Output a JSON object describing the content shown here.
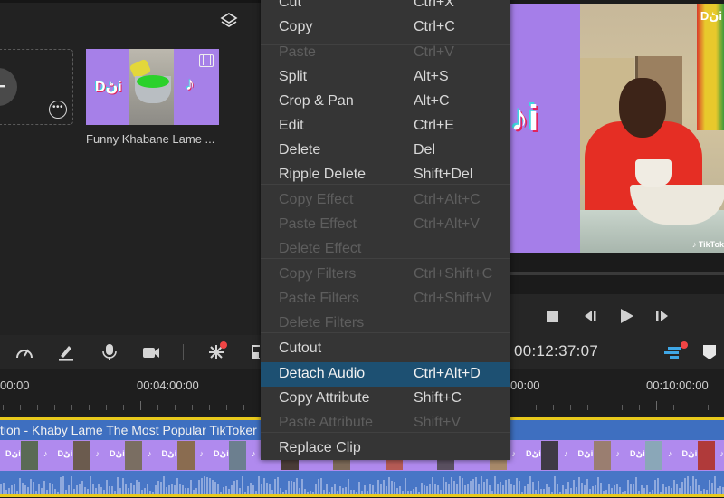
{
  "media": {
    "clip_label": "Funny Khabane Lame ...",
    "thumb_logo_left": "Dڻi",
    "thumb_logo_right": "♪"
  },
  "preview": {
    "watermark": "Dڻi",
    "tiktok_tag": "♪ TikTok",
    "side_logo": "♪i"
  },
  "toolbar": {
    "timecode": "00:12:37:07"
  },
  "ruler": {
    "labels": [
      "00:00",
      "00:04:00:00",
      "00:00",
      "00:10:00:00"
    ]
  },
  "track": {
    "title": "tion - Khaby Lame The Most Popular TikToker of Ap",
    "frame_logo": "Dڻi",
    "frame_logo2": "♪"
  },
  "context_menu": {
    "items": [
      {
        "label": "Cut",
        "shortcut": "Ctrl+X",
        "enabled": true
      },
      {
        "label": "Copy",
        "shortcut": "Ctrl+C",
        "enabled": true
      },
      {
        "label": "Paste",
        "shortcut": "Ctrl+V",
        "enabled": false
      },
      {
        "label": "Split",
        "shortcut": "Alt+S",
        "enabled": true
      },
      {
        "label": "Crop & Pan",
        "shortcut": "Alt+C",
        "enabled": true
      },
      {
        "label": "Edit",
        "shortcut": "Ctrl+E",
        "enabled": true
      },
      {
        "label": "Delete",
        "shortcut": "Del",
        "enabled": true
      },
      {
        "label": "Ripple Delete",
        "shortcut": "Shift+Del",
        "enabled": true
      },
      {
        "label": "Copy Effect",
        "shortcut": "Ctrl+Alt+C",
        "enabled": false
      },
      {
        "label": "Paste Effect",
        "shortcut": "Ctrl+Alt+V",
        "enabled": false
      },
      {
        "label": "Delete Effect",
        "shortcut": "",
        "enabled": false
      },
      {
        "label": "Copy Filters",
        "shortcut": "Ctrl+Shift+C",
        "enabled": false
      },
      {
        "label": "Paste Filters",
        "shortcut": "Ctrl+Shift+V",
        "enabled": false
      },
      {
        "label": "Delete Filters",
        "shortcut": "",
        "enabled": false
      },
      {
        "label": "Cutout",
        "shortcut": "",
        "enabled": true
      },
      {
        "label": "Detach Audio",
        "shortcut": "Ctrl+Alt+D",
        "enabled": true,
        "highlighted": true
      },
      {
        "label": "Copy Attribute",
        "shortcut": "Shift+C",
        "enabled": true
      },
      {
        "label": "Paste Attribute",
        "shortcut": "Shift+V",
        "enabled": false
      },
      {
        "label": "Replace Clip",
        "shortcut": "",
        "enabled": true
      }
    ]
  },
  "colors": {
    "highlight": "#1d5072",
    "track_title": "#3e6fc0",
    "track_frames": "#b08aee",
    "track_audio": "#4876c6",
    "track_edge": "#e8c91c",
    "notify_dot": "#f04545",
    "accent_icon": "#3fa7e6"
  }
}
